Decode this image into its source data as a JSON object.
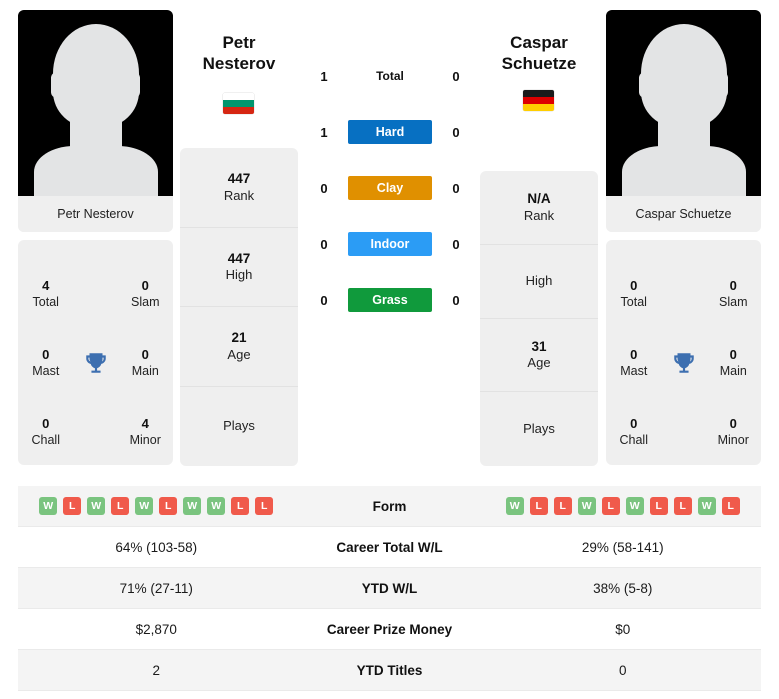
{
  "players": {
    "left": {
      "first_name": "Petr",
      "last_name": "Nesterov",
      "full_name": "Petr Nesterov",
      "country": "Bulgaria",
      "flag_colors": [
        "#ffffff",
        "#00966e",
        "#d62612"
      ],
      "rank": "447",
      "rank_label": "Rank",
      "high": "447",
      "high_label": "High",
      "age": "21",
      "age_label": "Age",
      "plays": "",
      "plays_label": "Plays",
      "titles": {
        "total": "4",
        "total_label": "Total",
        "slam": "0",
        "slam_label": "Slam",
        "mast": "0",
        "mast_label": "Mast",
        "main": "0",
        "main_label": "Main",
        "chall": "0",
        "chall_label": "Chall",
        "minor": "4",
        "minor_label": "Minor"
      },
      "form": [
        "W",
        "L",
        "W",
        "L",
        "W",
        "L",
        "W",
        "W",
        "L",
        "L"
      ],
      "career_wl": "64% (103-58)",
      "ytd_wl": "71% (27-11)",
      "career_prize": "$2,870",
      "ytd_titles": "2"
    },
    "right": {
      "first_name": "Caspar",
      "last_name": "Schuetze",
      "full_name": "Caspar Schuetze",
      "country": "Germany",
      "flag_colors": [
        "#1b1b1b",
        "#dd0000",
        "#ffce00"
      ],
      "rank": "N/A",
      "rank_label": "Rank",
      "high": "",
      "high_label": "High",
      "age": "31",
      "age_label": "Age",
      "plays": "",
      "plays_label": "Plays",
      "titles": {
        "total": "0",
        "total_label": "Total",
        "slam": "0",
        "slam_label": "Slam",
        "mast": "0",
        "mast_label": "Mast",
        "main": "0",
        "main_label": "Main",
        "chall": "0",
        "chall_label": "Chall",
        "minor": "0",
        "minor_label": "Minor"
      },
      "form": [
        "W",
        "L",
        "L",
        "W",
        "L",
        "W",
        "L",
        "L",
        "W",
        "L"
      ],
      "career_wl": "29% (58-141)",
      "ytd_wl": "38% (5-8)",
      "career_prize": "$0",
      "ytd_titles": "0"
    }
  },
  "head_to_head": {
    "rows": [
      {
        "label": "Total",
        "left": "1",
        "right": "0",
        "color": "transparent",
        "text_color": "#111111"
      },
      {
        "label": "Hard",
        "left": "1",
        "right": "0",
        "color": "#0770c2",
        "text_color": "#ffffff"
      },
      {
        "label": "Clay",
        "left": "0",
        "right": "0",
        "color": "#e09000",
        "text_color": "#ffffff"
      },
      {
        "label": "Indoor",
        "left": "0",
        "right": "0",
        "color": "#2b9cf5",
        "text_color": "#ffffff"
      },
      {
        "label": "Grass",
        "left": "0",
        "right": "0",
        "color": "#109a3c",
        "text_color": "#ffffff"
      }
    ]
  },
  "stats_rows": [
    {
      "label": "Form",
      "left": "",
      "right": ""
    },
    {
      "label": "Career Total W/L",
      "left": "64% (103-58)",
      "right": "29% (58-141)"
    },
    {
      "label": "YTD W/L",
      "left": "71% (27-11)",
      "right": "38% (5-8)"
    },
    {
      "label": "Career Prize Money",
      "left": "$2,870",
      "right": "$0"
    },
    {
      "label": "YTD Titles",
      "left": "2",
      "right": "0"
    }
  ],
  "colors": {
    "win_badge": "#7ac47f",
    "loss_badge": "#f05a4b",
    "trophy": "#3d6fb0",
    "panel": "#efefef"
  }
}
